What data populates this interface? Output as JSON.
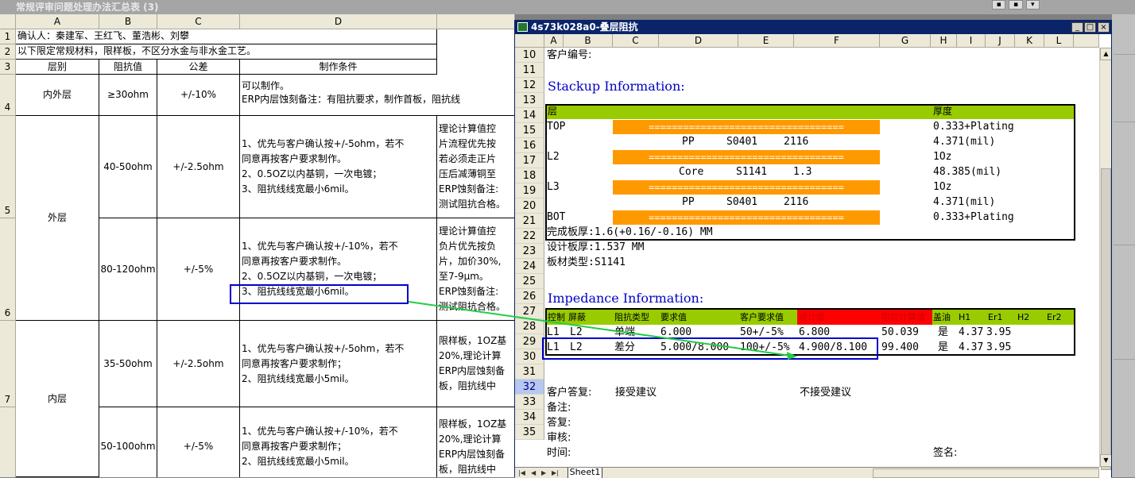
{
  "background_title": "常规评审问题处理办法汇总表 (3)",
  "sheet1": {
    "columns": [
      "A",
      "B",
      "C",
      "D"
    ],
    "rows": [
      "1",
      "2",
      "3",
      "4",
      "5",
      "6",
      "7"
    ],
    "r1": "确认人：秦建军、王红飞、董浩彬、刘攀",
    "r2": "以下限定常规材料，限样板，不区分水金与非水金工艺。",
    "headers": [
      "层别",
      "阻抗值",
      "公差",
      "制作条件"
    ],
    "r4": {
      "a": "内外层",
      "b": "≥30ohm",
      "c": "+/-10%",
      "d1": "可以制作。",
      "d2": "ERP内层蚀刻备注：有阻抗要求，制作首板，阻抗线"
    },
    "outer": "外层",
    "inner": "内层",
    "r5": {
      "b": "40-50ohm",
      "c": "+/-2.5ohm",
      "d": [
        "1、优先与客户确认按+/-5ohm，若不",
        "同意再按客户要求制作。",
        "2、0.5OZ以内基铜，一次电镀；",
        "3、阻抗线线宽最小6mil。"
      ],
      "e": [
        "理论计算值控",
        "片流程优先按",
        "若必须走正片",
        "压后减薄铜至",
        "ERP蚀刻备注:",
        "测试阻抗合格。"
      ]
    },
    "r6": {
      "b": "80-120ohm",
      "c": "+/-5%",
      "d": [
        "1、优先与客户确认按+/-10%，若不",
        "同意再按客户要求制作。",
        "2、0.5OZ以内基铜，一次电镀；",
        "3、阻抗线线宽最小6mil。"
      ],
      "e": [
        "理论计算值控",
        "负片优先按负",
        "片，加价30%,",
        "至7-9μm。",
        "ERP蚀刻备注:",
        "测试阻抗合格。"
      ]
    },
    "r7": {
      "b": "35-50ohm",
      "c": "+/-2.5ohm",
      "d": [
        "1、优先与客户确认按+/-5ohm，若不",
        "同意再按客户要求制作；",
        "2、阻抗线线宽最小5mil。"
      ],
      "e": [
        "限样板，1OZ基",
        "20%,理论计算",
        "ERP内层蚀刻备",
        "板，阻抗线中"
      ]
    },
    "r8": {
      "b": "50-100ohm",
      "c": "+/-5%",
      "d": [
        "1、优先与客户确认按+/-10%，若不",
        "同意再按客户要求制作；",
        "2、阻抗线线宽最小5mil。"
      ],
      "e": [
        "限样板，1OZ基",
        "20%,理论计算",
        "ERP内层蚀刻备",
        "板，阻抗线中"
      ]
    }
  },
  "window": {
    "title": "4s73k028a0-叠层阻抗",
    "min": "_",
    "max": "□",
    "close": "×",
    "columns": [
      "A",
      "B",
      "C",
      "D",
      "E",
      "F",
      "G",
      "H",
      "I",
      "J",
      "K",
      "L"
    ],
    "rows": [
      "10",
      "11",
      "12",
      "13",
      "14",
      "15",
      "16",
      "17",
      "18",
      "19",
      "20",
      "21",
      "22",
      "23",
      "24",
      "25",
      "26",
      "27",
      "28",
      "29",
      "30",
      "31",
      "32",
      "33",
      "34",
      "35"
    ],
    "customer_no": "客户编号:",
    "stackup_title": "Stackup Information:",
    "layer_hdr": "层",
    "thick_hdr": "厚度",
    "layers": [
      {
        "name": "TOP",
        "bar": "==================================",
        "thick": "0.333+Plating"
      },
      {
        "name": "",
        "pp": [
          "PP",
          "S0401",
          "2116"
        ],
        "thick": "4.371(mil)"
      },
      {
        "name": "L2",
        "bar": "==================================",
        "thick": "1Oz"
      },
      {
        "name": "",
        "pp": [
          "Core",
          "S1141",
          "1.3"
        ],
        "thick": "48.385(mil)"
      },
      {
        "name": "L3",
        "bar": "==================================",
        "thick": "1Oz"
      },
      {
        "name": "",
        "pp": [
          "PP",
          "S0401",
          "2116"
        ],
        "thick": "4.371(mil)"
      },
      {
        "name": "BOT",
        "bar": "==================================",
        "thick": "0.333+Plating"
      }
    ],
    "finish": "完成板厚:1.6(+0.16/-0.16) MM",
    "design": "设计板厚:1.537 MM",
    "material": "板材类型:S1141",
    "imp_title": "Impedance Information:",
    "imp_hdr": [
      "控制",
      "屏蔽",
      "阻抗类型",
      "要求值",
      "客户要求值",
      "设计值",
      "阻抗计算值",
      "盖油",
      "H1",
      "Er1",
      "H2",
      "Er2"
    ],
    "imp_rows": [
      [
        "L1",
        "L2",
        "单端",
        "6.000",
        "50+/-5%",
        "6.800",
        "50.039",
        "是",
        "4.37",
        "3.95"
      ],
      [
        "L1",
        "L2",
        "差分",
        "5.000/8.000",
        "100+/-5%",
        "4.900/8.100",
        "99.400",
        "是",
        "4.37",
        "3.95"
      ]
    ],
    "reply": "客户答复:",
    "accept": "接受建议",
    "reject": "不接受建议",
    "note": "备注:",
    "answer": "答复:",
    "audit": "审核:",
    "time": "时间:",
    "sign": "签名:",
    "sheet_tab": "Sheet1"
  },
  "colors": {
    "green": "#99cc00",
    "orange": "#ff9900",
    "red": "#ff0000",
    "title_blue": "#0000c8",
    "highlight": "#0000cc",
    "arrow": "#22cc44"
  }
}
